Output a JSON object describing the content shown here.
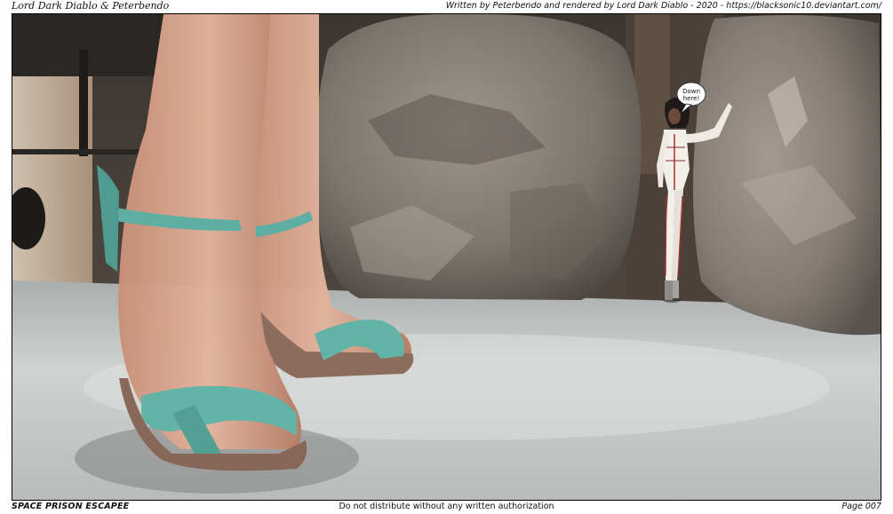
{
  "header": {
    "left_credit": "Lord Dark Diablo & Peterbendo",
    "right_credit": "Written by Peterbendo and rendered by Lord Dark Diablo - 2020 - https://blacksonic10.deviantart.com/"
  },
  "speech_bubble": {
    "line1": "Down",
    "line2": "here!"
  },
  "footer": {
    "series_title": "SPACE PRISON ESCAPEE",
    "notice": "Do not distribute without any written authorization",
    "page_label": "Page 007"
  },
  "colors": {
    "sandal_strap": "#5fb3a6",
    "floor": "#c9ccca",
    "rock": "#8c847c",
    "suit": "#f2eeea",
    "suit_trim": "#b0302a"
  }
}
